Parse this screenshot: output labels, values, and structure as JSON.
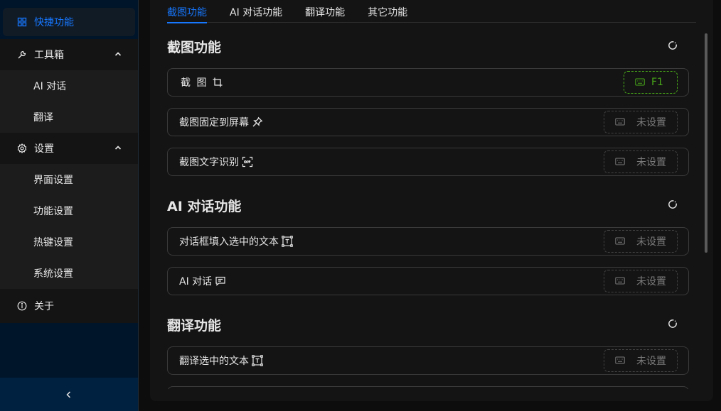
{
  "sidebar": {
    "items": [
      {
        "label": "快捷功能",
        "icon": "grid-icon"
      },
      {
        "label": "工具箱",
        "icon": "tool-icon"
      },
      {
        "label": "AI 对话"
      },
      {
        "label": "翻译"
      },
      {
        "label": "设置",
        "icon": "gear-icon"
      },
      {
        "label": "界面设置"
      },
      {
        "label": "功能设置"
      },
      {
        "label": "热键设置"
      },
      {
        "label": "系统设置"
      },
      {
        "label": "关于",
        "icon": "info-icon"
      }
    ]
  },
  "tabs": [
    {
      "label": "截图功能"
    },
    {
      "label": "AI 对话功能"
    },
    {
      "label": "翻译功能"
    },
    {
      "label": "其它功能"
    }
  ],
  "sections": [
    {
      "title": "截图功能",
      "rows": [
        {
          "label": "截 图",
          "icon": "crop-icon",
          "hotkey": "F1"
        },
        {
          "label": "截图固定到屏幕",
          "icon": "pin-icon",
          "hotkey": "未设置"
        },
        {
          "label": "截图文字识别",
          "icon": "ocr-icon",
          "hotkey": "未设置"
        }
      ]
    },
    {
      "title": "AI 对话功能",
      "rows": [
        {
          "label": "对话框填入选中的文本",
          "icon": "text-select-icon",
          "hotkey": "未设置"
        },
        {
          "label": "AI 对话",
          "icon": "chat-icon",
          "hotkey": "未设置"
        }
      ]
    },
    {
      "title": "翻译功能",
      "rows": [
        {
          "label": "翻译选中的文本",
          "icon": "text-select-icon",
          "hotkey": "未设置"
        }
      ]
    }
  ],
  "colors": {
    "accent": "#1677ff",
    "hotkey_set": "#49aa19",
    "sidebar_bg": "#001529"
  }
}
